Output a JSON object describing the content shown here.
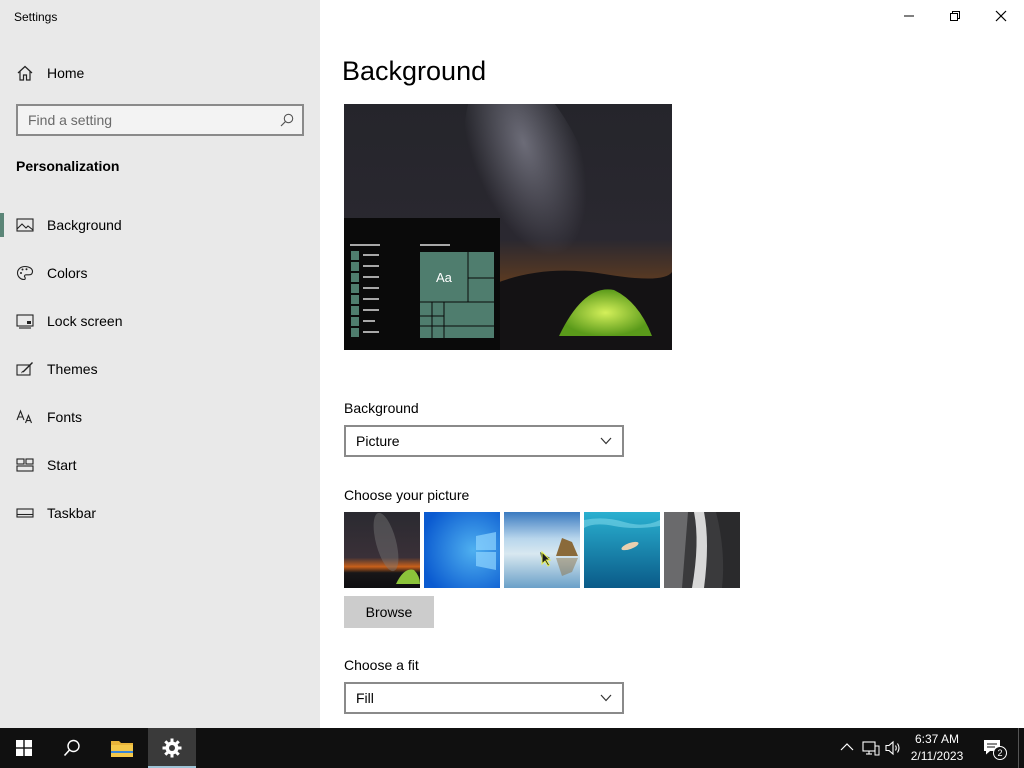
{
  "window": {
    "title": "Settings"
  },
  "sidebar": {
    "home_label": "Home",
    "search_placeholder": "Find a setting",
    "section_title": "Personalization",
    "items": [
      {
        "label": "Background",
        "icon": "picture-icon",
        "active": true
      },
      {
        "label": "Colors",
        "icon": "palette-icon",
        "active": false
      },
      {
        "label": "Lock screen",
        "icon": "lock-screen-icon",
        "active": false
      },
      {
        "label": "Themes",
        "icon": "themes-icon",
        "active": false
      },
      {
        "label": "Fonts",
        "icon": "fonts-icon",
        "active": false
      },
      {
        "label": "Start",
        "icon": "start-icon",
        "active": false
      },
      {
        "label": "Taskbar",
        "icon": "taskbar-icon",
        "active": false
      }
    ]
  },
  "main": {
    "title": "Background",
    "preview": {
      "tile_text": "Aa"
    },
    "background_label": "Background",
    "background_value": "Picture",
    "choose_picture_label": "Choose your picture",
    "pictures": [
      "milky-way-tent",
      "windows-blue",
      "beach-rocks",
      "underwater-swimmer",
      "waterfall-cliff"
    ],
    "browse_label": "Browse",
    "choose_fit_label": "Choose a fit",
    "fit_value": "Fill"
  },
  "taskbar": {
    "time": "6:37 AM",
    "date": "2/11/2023",
    "notification_count": "2"
  },
  "colors": {
    "accent": "#5b8577",
    "sidebar_bg": "#e9e9e9",
    "taskbar_bg": "#101010"
  }
}
